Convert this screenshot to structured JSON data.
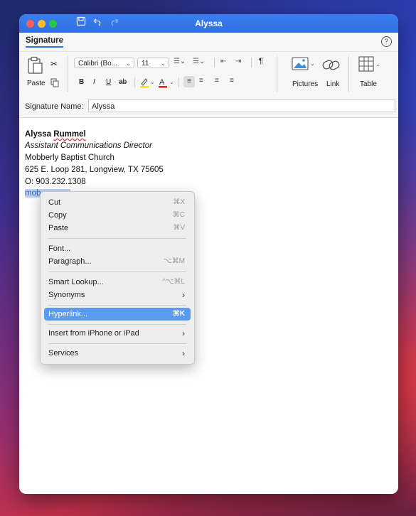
{
  "window": {
    "title": "Alyssa"
  },
  "ribbon": {
    "tab": "Signature",
    "paste_label": "Paste",
    "font_name": "Calibri (Bo...",
    "font_size": "11",
    "bold": "B",
    "italic": "I",
    "underline": "U",
    "strike": "ab",
    "pilcrow": "¶",
    "pictures_label": "Pictures",
    "link_label": "Link",
    "table_label": "Table"
  },
  "signature_name": {
    "label": "Signature Name:",
    "value": "Alyssa"
  },
  "signature": {
    "name_first": "Alyssa ",
    "name_last": "Rummel",
    "title": "Assistant Communications Director",
    "org": "Mobberly Baptist Church",
    "address": "625 E. Loop 281, Longview, TX 75605",
    "phone": "O: 903.232.1308",
    "link_fragment": "mob"
  },
  "context_menu": {
    "cut": {
      "label": "Cut",
      "shortcut": "⌘X"
    },
    "copy": {
      "label": "Copy",
      "shortcut": "⌘C"
    },
    "paste": {
      "label": "Paste",
      "shortcut": "⌘V"
    },
    "font": {
      "label": "Font..."
    },
    "paragraph": {
      "label": "Paragraph...",
      "shortcut": "⌥⌘M"
    },
    "smart_lookup": {
      "label": "Smart Lookup...",
      "shortcut": "^⌥⌘L"
    },
    "synonyms": {
      "label": "Synonyms"
    },
    "hyperlink": {
      "label": "Hyperlink...",
      "shortcut": "⌘K"
    },
    "insert_iphone": {
      "label": "Insert from iPhone or iPad"
    },
    "services": {
      "label": "Services"
    }
  },
  "colors": {
    "titlebar": "#2f6fe0",
    "menu_highlight": "#5a9bf0",
    "selection": "#b8d4f8"
  }
}
